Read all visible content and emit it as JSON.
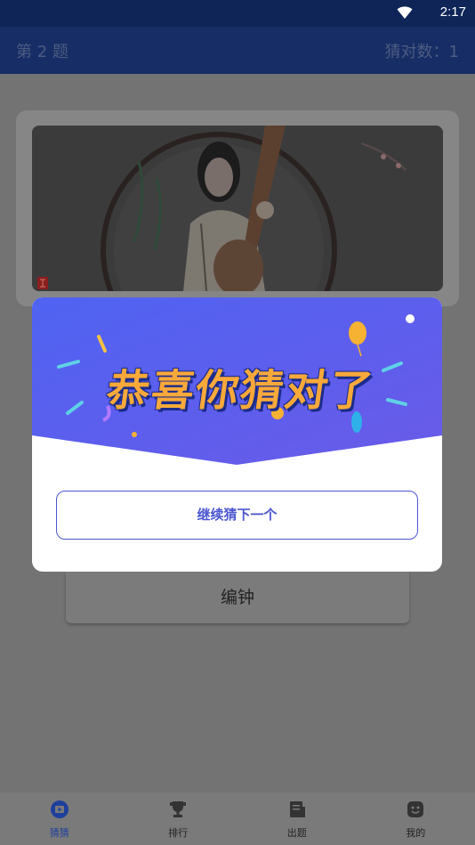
{
  "status_bar": {
    "time": "2:17",
    "wifi_icon": "wifi-icon"
  },
  "header": {
    "question_number": "第 2 题",
    "score": "猜对数：1"
  },
  "question": {
    "image_icon": "pipa-player-photo",
    "seal_icon": "red-seal-icon"
  },
  "answer_option": {
    "label": "编钟"
  },
  "dialog": {
    "headline": "恭喜你猜对了",
    "next_button": "继续猜下一个",
    "colors": {
      "banner": "#5b5ff0",
      "headline_fill": "#f9a93a",
      "button_border": "#4b56cf"
    }
  },
  "tabs": [
    {
      "label": "猜猜",
      "icon": "play-icon",
      "active": true
    },
    {
      "label": "排行",
      "icon": "trophy-icon",
      "active": false
    },
    {
      "label": "出题",
      "icon": "document-icon",
      "active": false
    },
    {
      "label": "我的",
      "icon": "face-icon",
      "active": false
    }
  ]
}
